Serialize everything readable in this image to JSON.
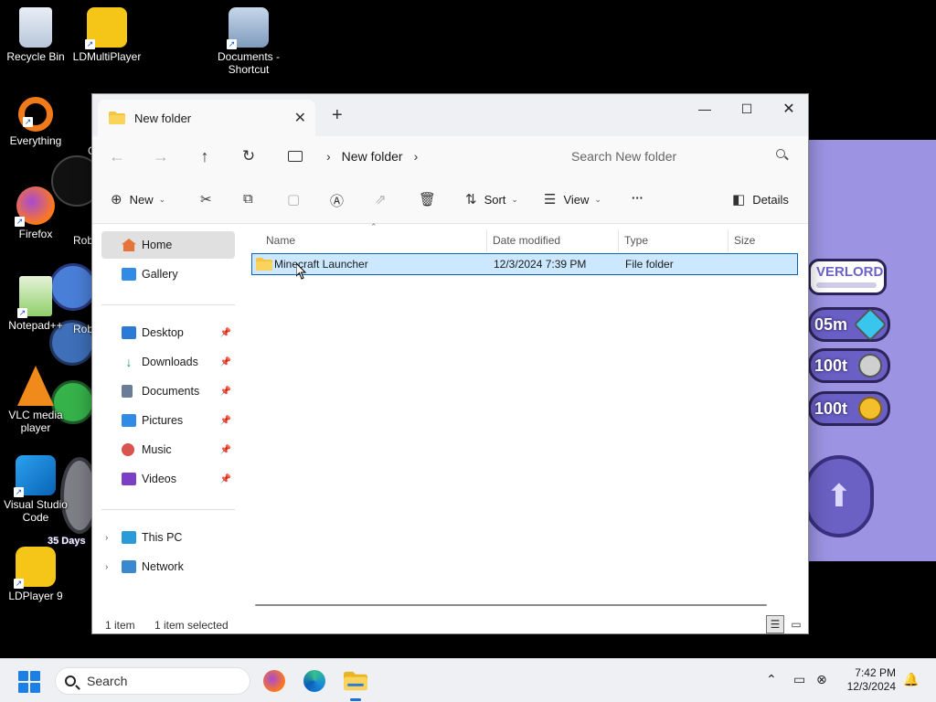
{
  "desktop": {
    "icons": [
      {
        "label": "Recycle Bin",
        "icon": "recycle-bin-icon"
      },
      {
        "label": "LDMultiPlayer",
        "icon": "ldmultiplayer-icon"
      },
      {
        "label": "Documents - Shortcut",
        "icon": "documents-shortcut-icon"
      },
      {
        "label": "Everything",
        "icon": "everything-icon"
      },
      {
        "label": "Firefox",
        "icon": "firefox-icon"
      },
      {
        "label": "Notepad++",
        "icon": "notepadpp-icon"
      },
      {
        "label": "VLC media player",
        "icon": "vlc-icon"
      },
      {
        "label": "Visual Studio Code",
        "icon": "vscode-icon"
      },
      {
        "label": "LDPlayer 9",
        "icon": "ldplayer-icon"
      }
    ],
    "partial_labels": {
      "c": "C",
      "rob1": "Rob",
      "rob2": "Rob",
      "days": "35 Days"
    },
    "game": {
      "name_text": "VERLORD",
      "stat1": "05m",
      "stat2": "100t",
      "stat3": "100t"
    }
  },
  "window": {
    "tab_title": "New folder",
    "tab_close": "✕",
    "new_tab": "+",
    "controls": {
      "minimize": "—",
      "maximize": "☐",
      "close": "✕"
    }
  },
  "address": {
    "breadcrumb": [
      "New folder"
    ],
    "search_placeholder": "Search New folder"
  },
  "toolbar": {
    "new_label": "New",
    "sort_label": "Sort",
    "view_label": "View",
    "more_label": "···",
    "details_label": "Details"
  },
  "nav": {
    "home": "Home",
    "gallery": "Gallery",
    "quick_access": [
      {
        "label": "Desktop",
        "icon": "desktop-icon",
        "color": "#2b7bd6"
      },
      {
        "label": "Downloads",
        "icon": "downloads-icon",
        "color": "#1f9e59"
      },
      {
        "label": "Documents",
        "icon": "documents-icon",
        "color": "#6b7d96"
      },
      {
        "label": "Pictures",
        "icon": "pictures-icon",
        "color": "#2f8be6"
      },
      {
        "label": "Music",
        "icon": "music-icon",
        "color": "#d9534f"
      },
      {
        "label": "Videos",
        "icon": "videos-icon",
        "color": "#7a3fc4"
      }
    ],
    "this_pc": "This PC",
    "network": "Network"
  },
  "columns": {
    "name": "Name",
    "date": "Date modified",
    "type": "Type",
    "size": "Size"
  },
  "files": [
    {
      "name": "Minecraft Launcher",
      "date": "12/3/2024 7:39 PM",
      "type": "File folder",
      "size": "",
      "selected": true
    }
  ],
  "status": {
    "count": "1 item",
    "selection": "1 item selected"
  },
  "taskbar": {
    "search_label": "Search",
    "time": "7:42 PM",
    "date": "12/3/2024",
    "apps": [
      "firefox-icon",
      "edge-icon",
      "file-explorer-icon"
    ]
  },
  "colors": {
    "accent": "#0b62ba",
    "selection": "#cce8ff",
    "game_bg": "#9c93e3",
    "folder": "#f4c542"
  }
}
